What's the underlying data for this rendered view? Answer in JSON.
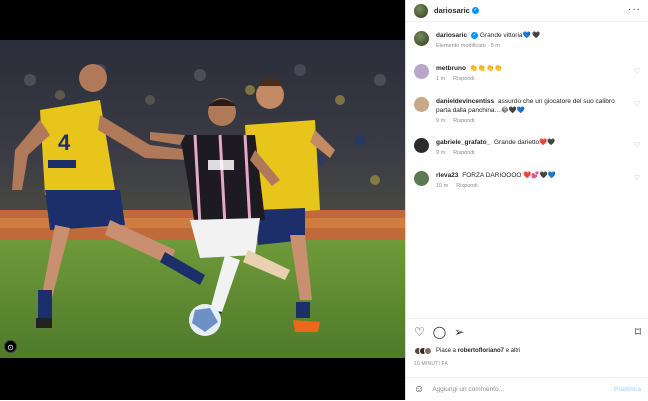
{
  "post": {
    "username": "dariosaric",
    "user_tag": "⊙",
    "caption": "Grande vittoria💙 🖤",
    "caption_meta": "Elemento modificato · 5 m",
    "more": "···"
  },
  "comments": [
    {
      "user": "metbruno",
      "text": "👏👏👏👏",
      "time": "1 m",
      "reply": "Rispondi",
      "avatar_color": "#b9a6c9"
    },
    {
      "user": "danieldevincentiss",
      "text": "assurdo che un giocatore del suo calibro parta dalla panchina…😂🖤💙",
      "time": "9 m",
      "reply": "Rispondi",
      "avatar_color": "#c7a98a"
    },
    {
      "user": "gabriele_grafato_",
      "text": "Grande darietto❤️🖤",
      "time": "9 m",
      "reply": "Rispondi",
      "avatar_color": "#2b2b2b"
    },
    {
      "user": "rleva23",
      "text": "FORZA DARIOOOO ❤️💕🖤💙",
      "time": "10 m",
      "reply": "Rispondi",
      "avatar_color": "#5c7a52"
    }
  ],
  "actions": {
    "like_icon": "heart-icon",
    "comment_icon": "comment-icon",
    "share_icon": "share-icon",
    "save_icon": "bookmark-icon",
    "likes_prefix": "Piace a ",
    "likes_user": "robertofloriano7",
    "likes_suffix": " e altri",
    "timestamp": "10 MINUTI FA"
  },
  "add_comment": {
    "placeholder": "Aggiungi un commento...",
    "publish": "Pubblica"
  },
  "colors": {
    "accent": "#0095f6",
    "muted": "#8e8e8e",
    "pubblica_disabled": "#b3dbff"
  }
}
